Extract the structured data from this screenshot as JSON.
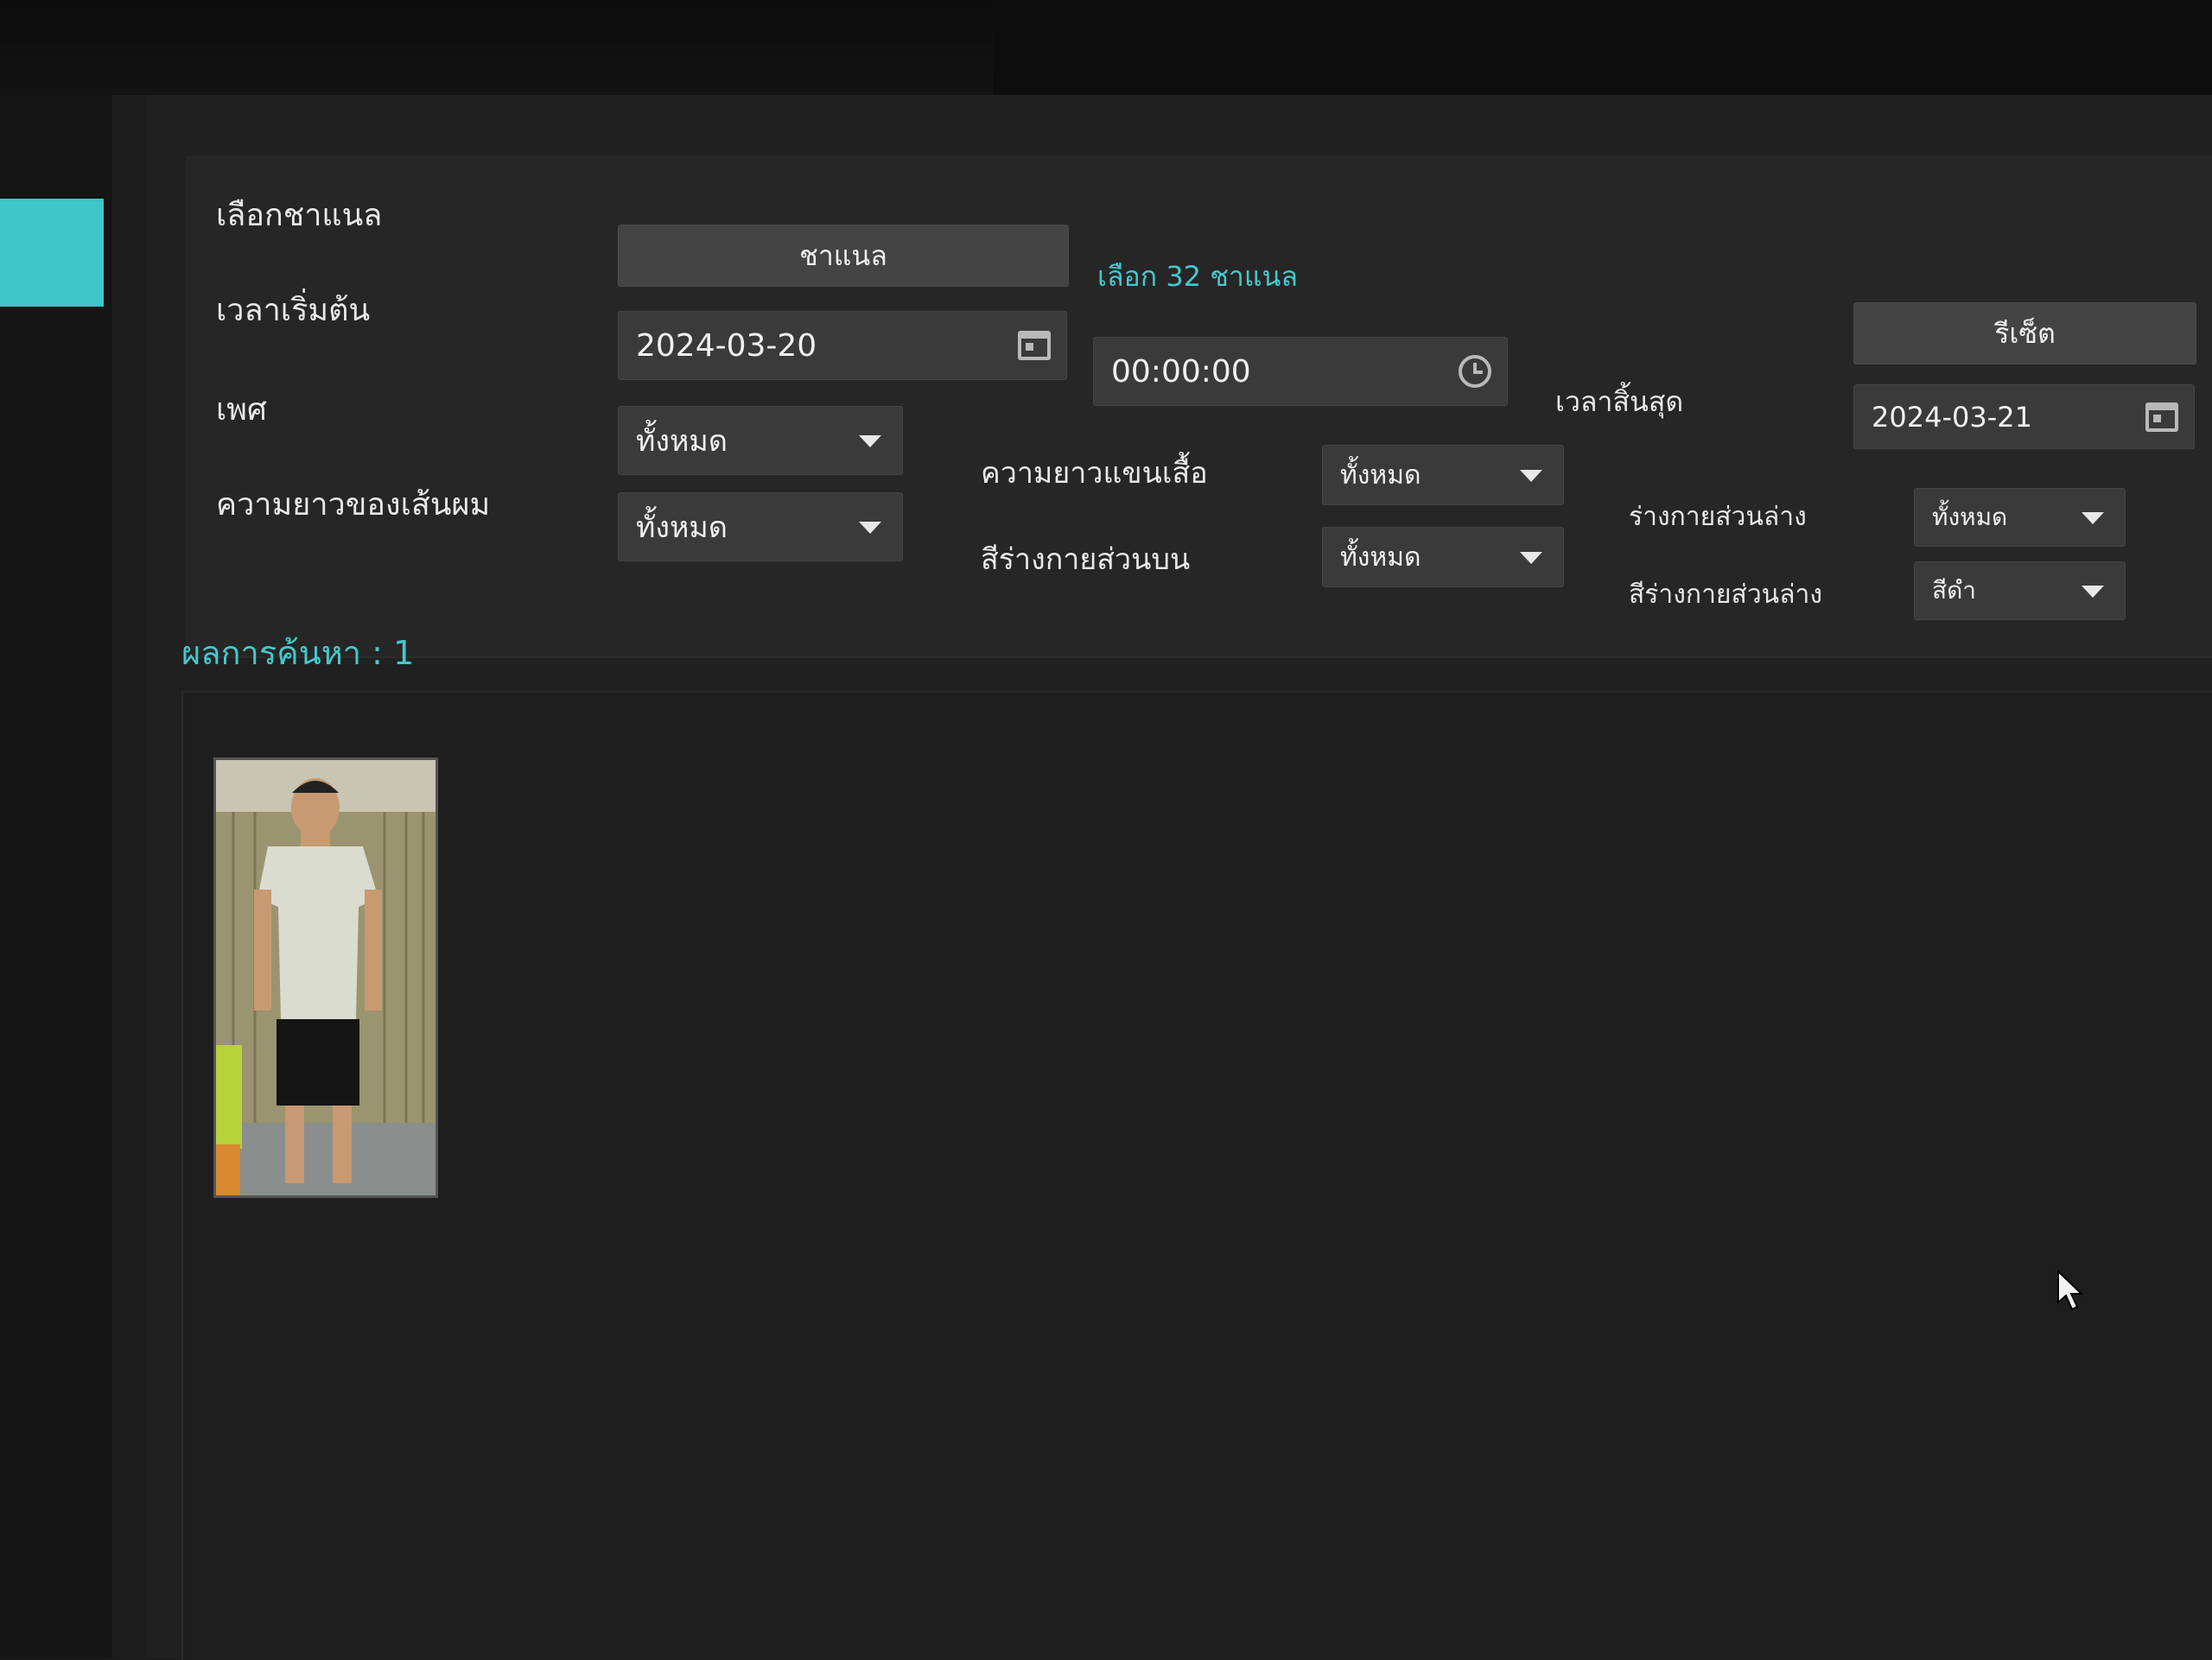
{
  "filters": {
    "channel_label": "เลือกชาแนล",
    "channel_button": "ชาแนล",
    "channel_selected": "เลือก 32 ชาแนล",
    "reset_button": "รีเซ็ต",
    "start_time_label": "เวลาเริ่มต้น",
    "start_date": "2024-03-20",
    "start_time": "00:00:00",
    "end_time_label": "เวลาสิ้นสุด",
    "end_date": "2024-03-21",
    "gender_label": "เพศ",
    "gender_value": "ทั้งหมด",
    "hair_length_label": "ความยาวของเส้นผม",
    "hair_length_value": "ทั้งหมด",
    "sleeve_length_label": "ความยาวแขนเสื้อ",
    "sleeve_length_value": "ทั้งหมด",
    "upper_color_label": "สีร่างกายส่วนบน",
    "upper_color_value": "ทั้งหมด",
    "lower_body_label": "ร่างกายส่วนล่าง",
    "lower_body_value": "ทั้งหมด",
    "lower_color_label": "สีร่างกายส่วนล่าง",
    "lower_color_value": "สีดำ"
  },
  "results": {
    "label": "ผลการค้นหา : 1"
  },
  "icons": [
    "calendar-icon",
    "clock-icon",
    "chevron-down-icon",
    "mouse-cursor-icon"
  ],
  "colors": {
    "accent": "#43c9cc",
    "background": "#202020",
    "panel": "#262626",
    "control": "#3a3a3a"
  }
}
